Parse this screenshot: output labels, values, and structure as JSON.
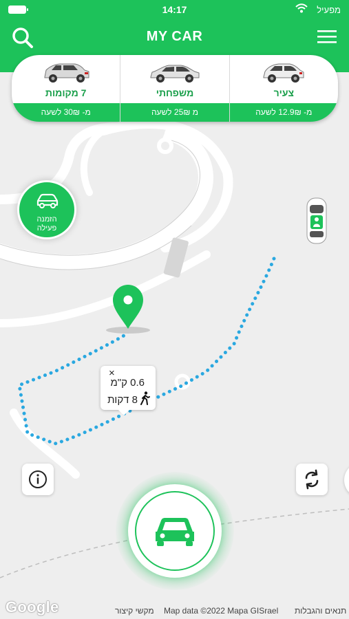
{
  "status_bar": {
    "time": "14:17",
    "carrier": "מפעיל"
  },
  "header": {
    "title": "MY CAR"
  },
  "categories": [
    {
      "name": "צעיר",
      "price": "מ- 12.9₪ לשעה"
    },
    {
      "name": "משפחתי",
      "price": "מ 25₪ לשעה"
    },
    {
      "name": "7 מקומות",
      "price": "מ- 30₪ לשעה"
    }
  ],
  "order_bubble": {
    "label_line1": "הזמנה",
    "label_line2": "פעילה"
  },
  "route_info": {
    "close": "×",
    "distance": "0.6 ק\"מ",
    "duration": "8 דקות"
  },
  "footer": {
    "google": "Google",
    "shortcuts": "מקשי קיצור",
    "map_data": "Map data ©2022 Mapa GISrael",
    "terms": "תנאים והגבלות"
  },
  "colors": {
    "brand": "#1dc25a",
    "route": "#2aa8e0",
    "map_bg": "#eeeeee"
  }
}
